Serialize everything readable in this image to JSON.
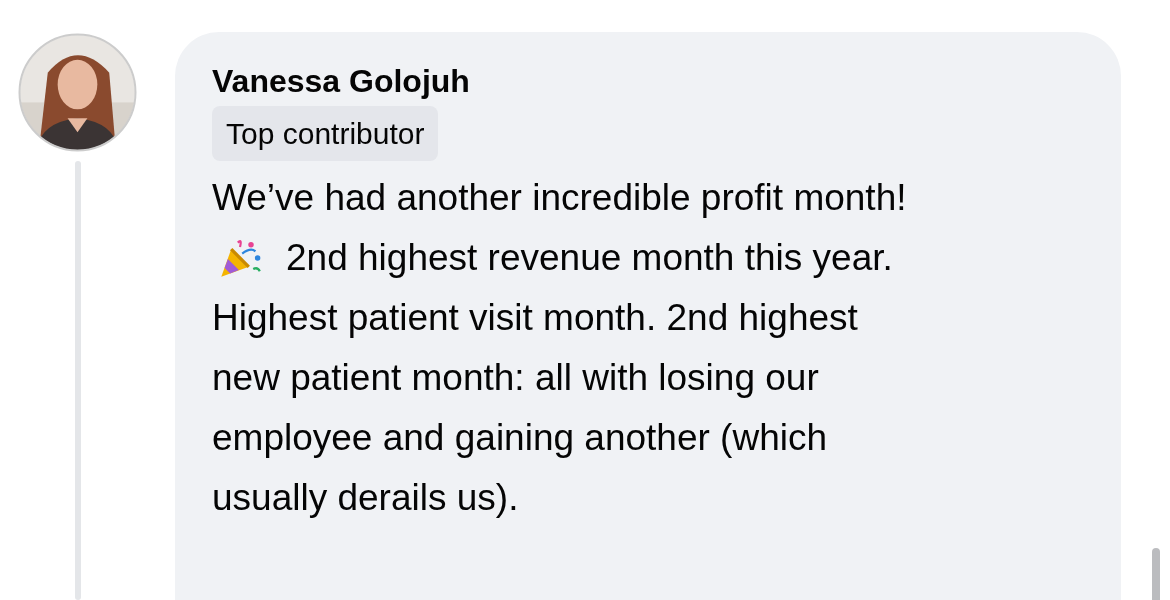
{
  "comment": {
    "author": "Vanessa Golojuh",
    "badge": "Top contributor",
    "message_lines": [
      "We’ve had another incredible profit month!",
      "2nd highest revenue month this year.",
      "Highest patient visit month. 2nd highest",
      "new patient month: all with losing our",
      "employee and gaining another (which",
      "usually derails us)."
    ]
  }
}
